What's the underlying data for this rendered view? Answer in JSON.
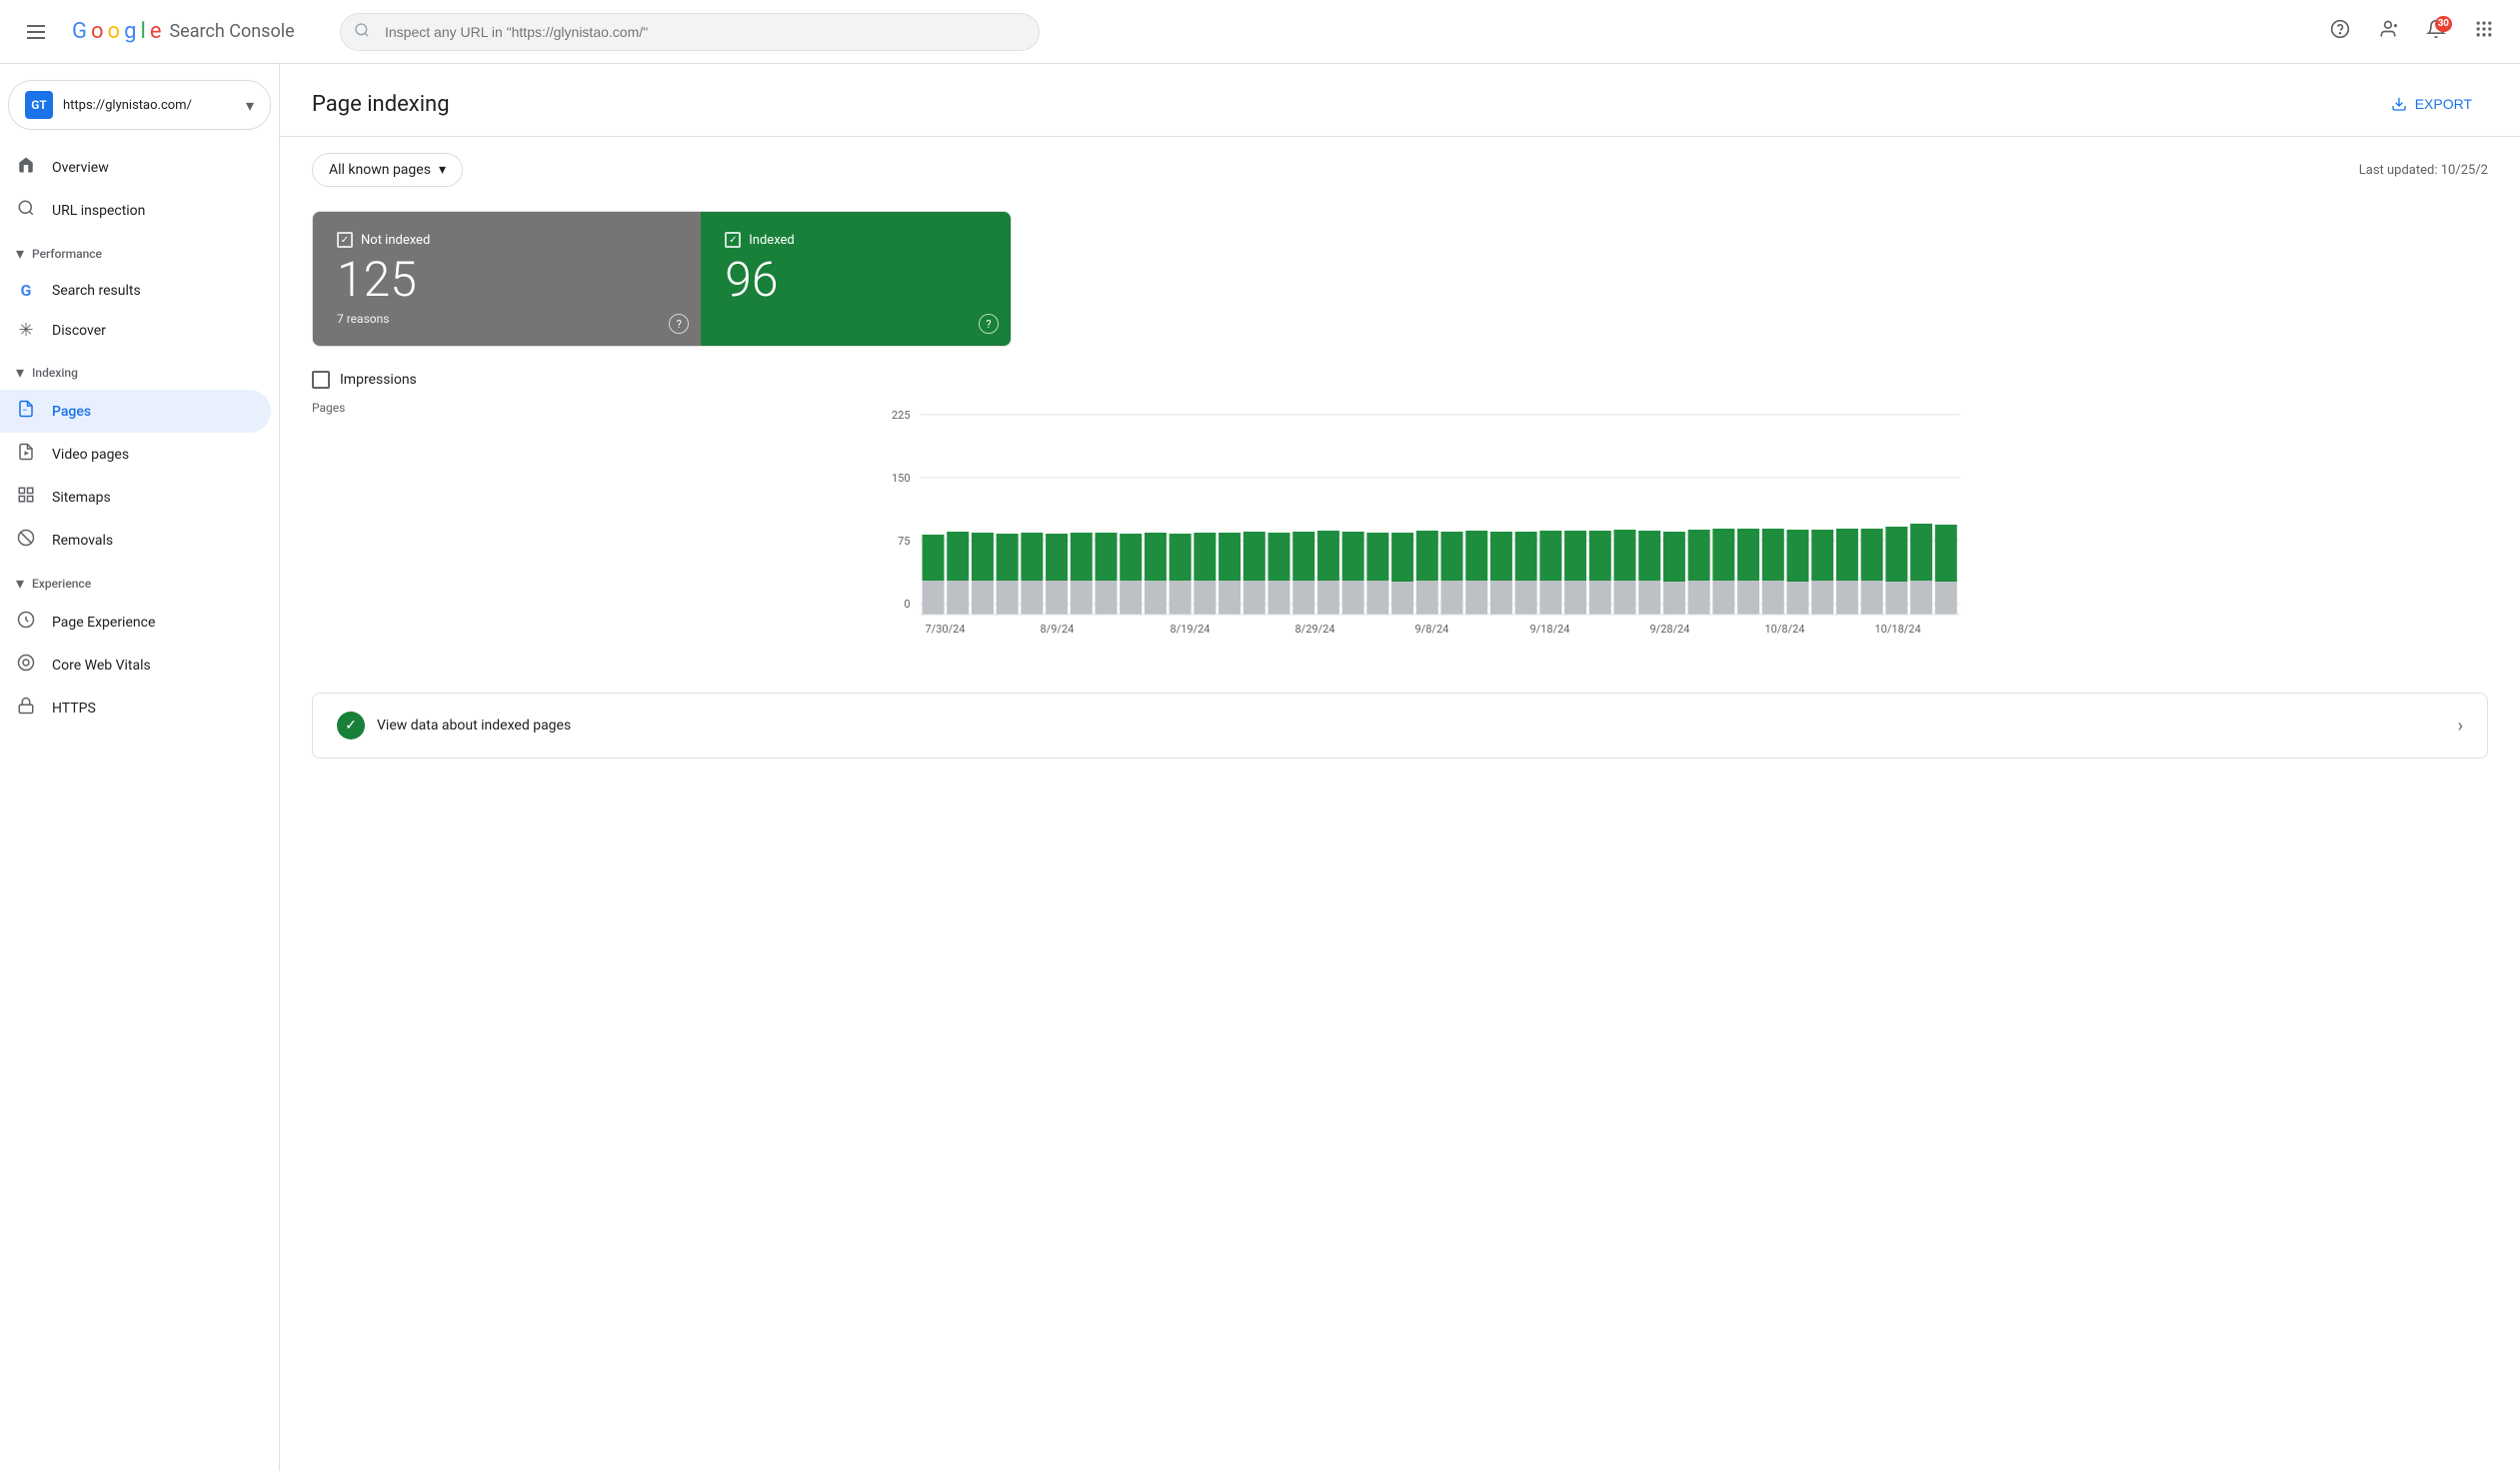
{
  "header": {
    "hamburger_label": "Main menu",
    "logo": {
      "g": "G",
      "o1": "o",
      "o2": "o",
      "g2": "g",
      "l": "l",
      "e": "e",
      "text": "Search Console"
    },
    "search_placeholder": "Inspect any URL in \"https://glynistao.com/\"",
    "icons": {
      "help": "?",
      "account": "👤",
      "notification": "🔔",
      "notification_count": "30",
      "apps": "⠿"
    }
  },
  "sidebar": {
    "property": {
      "avatar_text": "GT",
      "url": "https://glynistao.com/"
    },
    "nav_items": [
      {
        "id": "overview",
        "label": "Overview",
        "icon": "🏠",
        "active": false
      },
      {
        "id": "url-inspection",
        "label": "URL inspection",
        "icon": "🔍",
        "active": false
      }
    ],
    "sections": [
      {
        "id": "performance",
        "label": "Performance",
        "items": [
          {
            "id": "search-results",
            "label": "Search results",
            "icon": "G",
            "active": false
          },
          {
            "id": "discover",
            "label": "Discover",
            "icon": "✳",
            "active": false
          }
        ]
      },
      {
        "id": "indexing",
        "label": "Indexing",
        "items": [
          {
            "id": "pages",
            "label": "Pages",
            "icon": "📄",
            "active": true
          },
          {
            "id": "video-pages",
            "label": "Video pages",
            "icon": "🎬",
            "active": false
          },
          {
            "id": "sitemaps",
            "label": "Sitemaps",
            "icon": "⊞",
            "active": false
          },
          {
            "id": "removals",
            "label": "Removals",
            "icon": "🚫",
            "active": false
          }
        ]
      },
      {
        "id": "experience",
        "label": "Experience",
        "items": [
          {
            "id": "page-experience",
            "label": "Page Experience",
            "icon": "⚙",
            "active": false
          },
          {
            "id": "core-web-vitals",
            "label": "Core Web Vitals",
            "icon": "◎",
            "active": false
          },
          {
            "id": "https",
            "label": "HTTPS",
            "icon": "🔒",
            "active": false
          }
        ]
      }
    ]
  },
  "main": {
    "title": "Page indexing",
    "export_label": "EXPORT",
    "filter": {
      "label": "All known pages",
      "last_updated": "Last updated: 10/25/2"
    },
    "cards": {
      "not_indexed": {
        "label": "Not indexed",
        "count": "125",
        "subtitle": "7 reasons"
      },
      "indexed": {
        "label": "Indexed",
        "count": "96",
        "subtitle": ""
      }
    },
    "impressions": {
      "label": "Impressions"
    },
    "chart": {
      "y_label": "Pages",
      "y_axis": [
        "225",
        "150",
        "75",
        "0"
      ],
      "x_labels": [
        "7/30/24",
        "8/9/24",
        "8/19/24",
        "8/29/24",
        "9/8/24",
        "9/18/24",
        "9/28/24",
        "10/8/24",
        "10/18/24"
      ],
      "bars": [
        {
          "green": 52,
          "gray": 38
        },
        {
          "green": 55,
          "gray": 38
        },
        {
          "green": 54,
          "gray": 38
        },
        {
          "green": 53,
          "gray": 38
        },
        {
          "green": 54,
          "gray": 38
        },
        {
          "green": 53,
          "gray": 38
        },
        {
          "green": 54,
          "gray": 38
        },
        {
          "green": 54,
          "gray": 38
        },
        {
          "green": 53,
          "gray": 38
        },
        {
          "green": 54,
          "gray": 38
        },
        {
          "green": 53,
          "gray": 38
        },
        {
          "green": 54,
          "gray": 38
        },
        {
          "green": 54,
          "gray": 38
        },
        {
          "green": 55,
          "gray": 38
        },
        {
          "green": 54,
          "gray": 38
        },
        {
          "green": 55,
          "gray": 38
        },
        {
          "green": 56,
          "gray": 38
        },
        {
          "green": 55,
          "gray": 38
        },
        {
          "green": 54,
          "gray": 38
        },
        {
          "green": 55,
          "gray": 37
        },
        {
          "green": 56,
          "gray": 38
        },
        {
          "green": 55,
          "gray": 38
        },
        {
          "green": 56,
          "gray": 38
        },
        {
          "green": 55,
          "gray": 38
        },
        {
          "green": 55,
          "gray": 38
        },
        {
          "green": 56,
          "gray": 38
        },
        {
          "green": 56,
          "gray": 38
        },
        {
          "green": 56,
          "gray": 38
        },
        {
          "green": 57,
          "gray": 38
        },
        {
          "green": 56,
          "gray": 38
        },
        {
          "green": 56,
          "gray": 37
        },
        {
          "green": 57,
          "gray": 38
        },
        {
          "green": 58,
          "gray": 38
        },
        {
          "green": 58,
          "gray": 38
        },
        {
          "green": 58,
          "gray": 38
        },
        {
          "green": 58,
          "gray": 37
        },
        {
          "green": 57,
          "gray": 38
        },
        {
          "green": 58,
          "gray": 38
        },
        {
          "green": 59,
          "gray": 38
        },
        {
          "green": 62,
          "gray": 37
        },
        {
          "green": 64,
          "gray": 38
        },
        {
          "green": 64,
          "gray": 37
        }
      ],
      "max_value": 225
    },
    "view_data": {
      "label": "View data about indexed pages"
    }
  }
}
